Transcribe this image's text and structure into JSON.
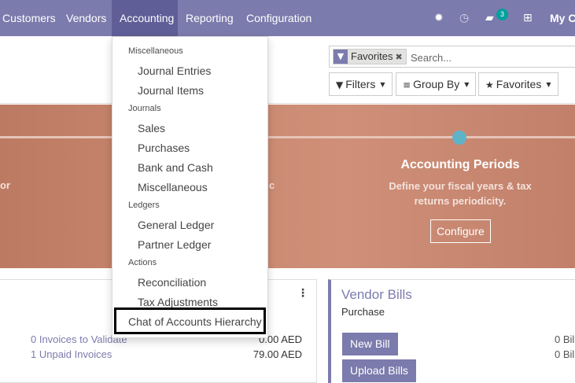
{
  "navbar": {
    "items": [
      "Customers",
      "Vendors",
      "Accounting",
      "Reporting",
      "Configuration"
    ],
    "active": "Accounting",
    "messages_count": "3",
    "company": "My C",
    "icons": [
      "bug-icon",
      "clock-icon",
      "chat-icon",
      "gift-icon"
    ]
  },
  "search": {
    "facet_label": "Favorites",
    "placeholder": "Search..."
  },
  "control_buttons": {
    "filters": "Filters",
    "group_by": "Group By",
    "favorites": "Favorites"
  },
  "banner": {
    "left_fragment": "or",
    "mid_fragment": "c",
    "title": "Accounting Periods",
    "description_line1": "Define your fiscal years & tax",
    "description_line2": "returns periodicity.",
    "button": "Configure"
  },
  "dropdown": {
    "sections": [
      {
        "header": "Miscellaneous",
        "items": [
          "Journal Entries",
          "Journal Items"
        ]
      },
      {
        "header": "Journals",
        "items": [
          "Sales",
          "Purchases",
          "Bank and Cash",
          "Miscellaneous"
        ]
      },
      {
        "header": "Ledgers",
        "items": [
          "General Ledger",
          "Partner Ledger"
        ]
      },
      {
        "header": "Actions",
        "items": [
          "Reconciliation",
          "Tax Adjustments"
        ]
      }
    ],
    "highlighted_item": "Chat of Accounts Hierarchy"
  },
  "left_card": {
    "rows": [
      {
        "label": "0 Invoices to Validate",
        "amount": "0.00 AED"
      },
      {
        "label": "1 Unpaid Invoices",
        "amount": "79.00 AED"
      }
    ]
  },
  "vendor_card": {
    "title": "Vendor Bills",
    "subtitle": "Purchase",
    "new_bill": "New Bill",
    "upload_bills": "Upload Bills",
    "right_fragment_1": "0 Bil",
    "right_fragment_2": "0 Bil"
  },
  "colors": {
    "brand": "#7c7bad",
    "brand_dark": "#5f5e97",
    "badge": "#00a09d",
    "banner": "#c98870"
  }
}
